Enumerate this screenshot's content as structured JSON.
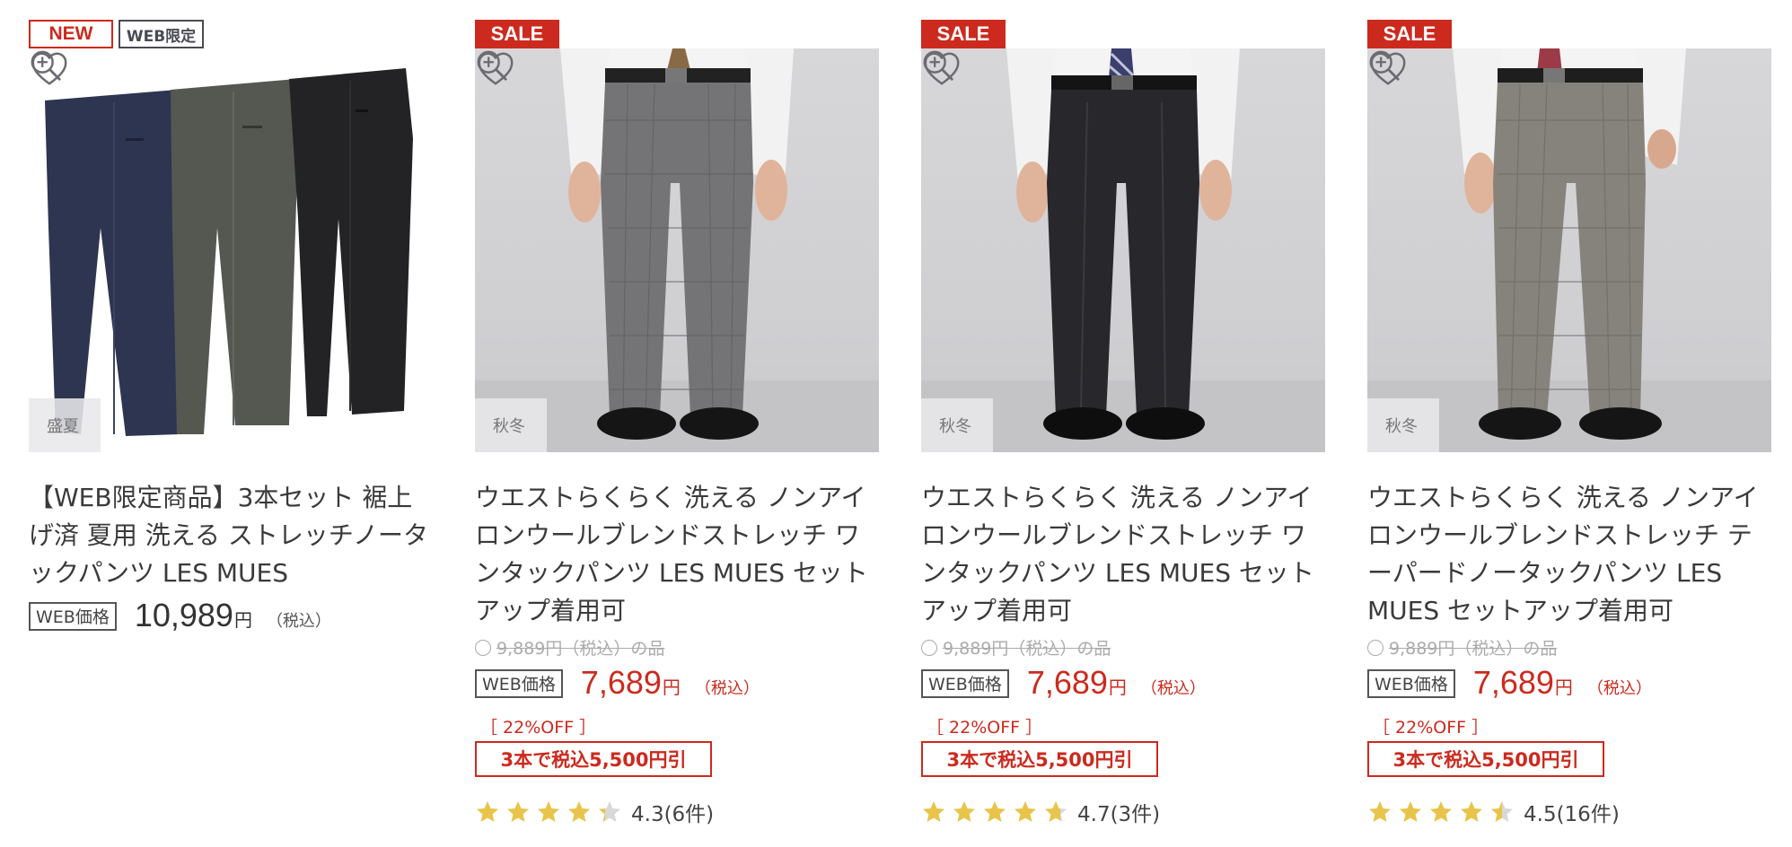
{
  "colors": {
    "sale_red": "#cc2a1e",
    "star_yellow": "#e8c44a",
    "star_empty": "#d8d8d8"
  },
  "products": [
    {
      "badges": [
        "NEW",
        "WEB限定"
      ],
      "season": "盛夏",
      "title": "【WEB限定商品】3本セット 裾上げ済 夏用 洗える ストレッチノータックパンツ LES MUES",
      "web_price_label": "WEB価格",
      "price": "10,989",
      "yen": "円",
      "tax": "（税込）",
      "on_sale": false,
      "icons": [
        "heart-icon",
        "zoom-icon"
      ]
    },
    {
      "badges": [
        "SALE"
      ],
      "season": "秋冬",
      "title": "ウエストらくらく 洗える ノンアイロンウールブレンドストレッチ ワンタックパンツ LES MUES セットアップ着用可",
      "original_price": "9,889円（税込）の品",
      "web_price_label": "WEB価格",
      "price": "7,689",
      "yen": "円",
      "tax": "（税込）",
      "discount": "［ 22%OFF ］",
      "bundle_offer": "3本で税込5,500円引",
      "rating": 4.3,
      "rating_text": "4.3(6件)",
      "on_sale": true
    },
    {
      "badges": [
        "SALE"
      ],
      "season": "秋冬",
      "title": "ウエストらくらく 洗える ノンアイロンウールブレンドストレッチ ワンタックパンツ LES MUES セットアップ着用可",
      "original_price": "9,889円（税込）の品",
      "web_price_label": "WEB価格",
      "price": "7,689",
      "yen": "円",
      "tax": "（税込）",
      "discount": "［ 22%OFF ］",
      "bundle_offer": "3本で税込5,500円引",
      "rating": 4.7,
      "rating_text": "4.7(3件)",
      "on_sale": true
    },
    {
      "badges": [
        "SALE"
      ],
      "season": "秋冬",
      "title": "ウエストらくらく 洗える ノンアイロンウールブレンドストレッチ テーパードノータックパンツ LES MUES セットアップ着用可",
      "original_price": "9,889円（税込）の品",
      "web_price_label": "WEB価格",
      "price": "7,689",
      "yen": "円",
      "tax": "（税込）",
      "discount": "［ 22%OFF ］",
      "bundle_offer": "3本で税込5,500円引",
      "rating": 4.5,
      "rating_text": "4.5(16件)",
      "on_sale": true
    }
  ]
}
